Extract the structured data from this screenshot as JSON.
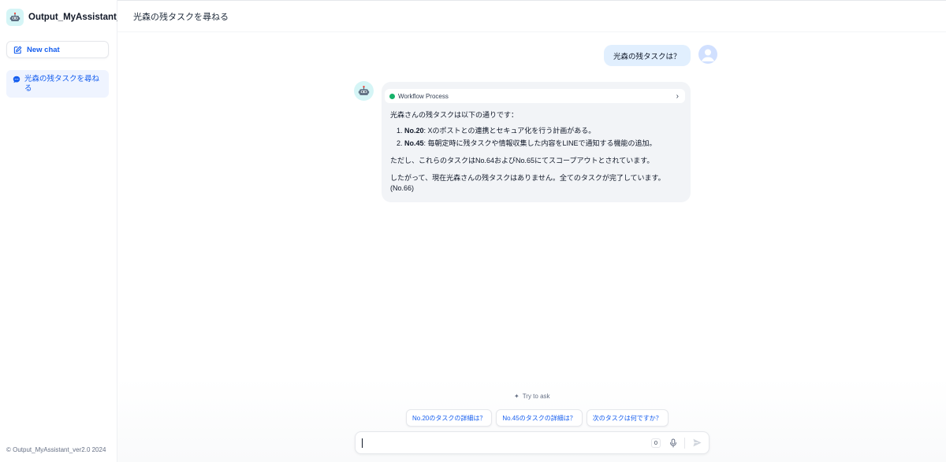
{
  "app": {
    "title": "Output_MyAssistant_ver2.0",
    "copyright": "© Output_MyAssistant_ver2.0 2024"
  },
  "sidebar": {
    "new_chat_label": "New chat",
    "conversations": [
      {
        "label": "光森の残タスクを尋ねる",
        "active": true
      }
    ]
  },
  "chat": {
    "title": "光森の残タスクを尋ねる",
    "user_message": "光森の残タスクは？",
    "workflow_label": "Workflow Process",
    "bot": {
      "intro": "光森さんの残タスクは以下の通りです：",
      "items": [
        {
          "num": "1.",
          "key": "No.20",
          "text": ": Xのポストとの連携とセキュア化を行う計画がある。"
        },
        {
          "num": "2.",
          "key": "No.45",
          "text": ": 毎朝定時に残タスクや情報収集した内容をLINEで通知する機能の追加。"
        }
      ],
      "para2": "ただし、これらのタスクはNo.64およびNo.65にてスコープアウトとされています。",
      "para3": "したがって、現在光森さんの残タスクはありません。全てのタスクが完了しています。",
      "para3b": "(No.66)"
    },
    "try_ask_label": "Try to ask",
    "suggestions": [
      "No.20のタスクの詳細は？",
      "No.45のタスクの詳細は？",
      "次のタスクは何ですか？"
    ],
    "input": {
      "value": "",
      "char_count": "0"
    }
  },
  "colors": {
    "accent": "#155eef",
    "user_bubble": "#e1effe",
    "bot_bubble": "#f2f4f7",
    "workflow_status": "#17b26a"
  },
  "icons": {
    "app_logo": "robot-icon",
    "new_chat": "edit-icon",
    "conversation": "chat-bubble-icon",
    "user_avatar": "user-icon",
    "workflow_status": "success-dot-icon",
    "workflow_expand": "chevron-right-icon",
    "mic": "microphone-icon",
    "send": "send-icon"
  }
}
